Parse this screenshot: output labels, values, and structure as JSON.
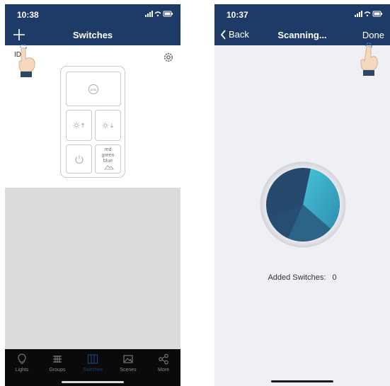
{
  "left_screen": {
    "status": {
      "time": "10:38"
    },
    "nav": {
      "title": "Switches",
      "add_icon": "plus-icon"
    },
    "device_id_label": "ID",
    "settings_icon": "gear-icon",
    "remote": {
      "top_button_label": "auto",
      "brightness_up_icon": "sun-up-icon",
      "brightness_down_icon": "sun-down-icon",
      "power_icon": "power-icon",
      "color_button": {
        "line1": "red",
        "line2": "green",
        "line3": "blue"
      }
    },
    "tabs": [
      {
        "label": "Lights",
        "icon": "bulb-icon"
      },
      {
        "label": "Groups",
        "icon": "groups-icon"
      },
      {
        "label": "Switches",
        "icon": "switches-icon",
        "active": true
      },
      {
        "label": "Scenes",
        "icon": "scenes-icon"
      },
      {
        "label": "More",
        "icon": "share-icon"
      }
    ]
  },
  "right_screen": {
    "status": {
      "time": "10:37"
    },
    "nav": {
      "back_label": "Back",
      "title": "Scanning...",
      "done_label": "Done"
    },
    "added_label": "Added Switches:",
    "added_count": "0"
  },
  "colors": {
    "nav_bar": "#1e3a66",
    "tab_bar": "#0a0a0a",
    "active_tab": "#1f3e72",
    "scan_dark": "#2a5172",
    "scan_light": "#3fb3c9"
  }
}
